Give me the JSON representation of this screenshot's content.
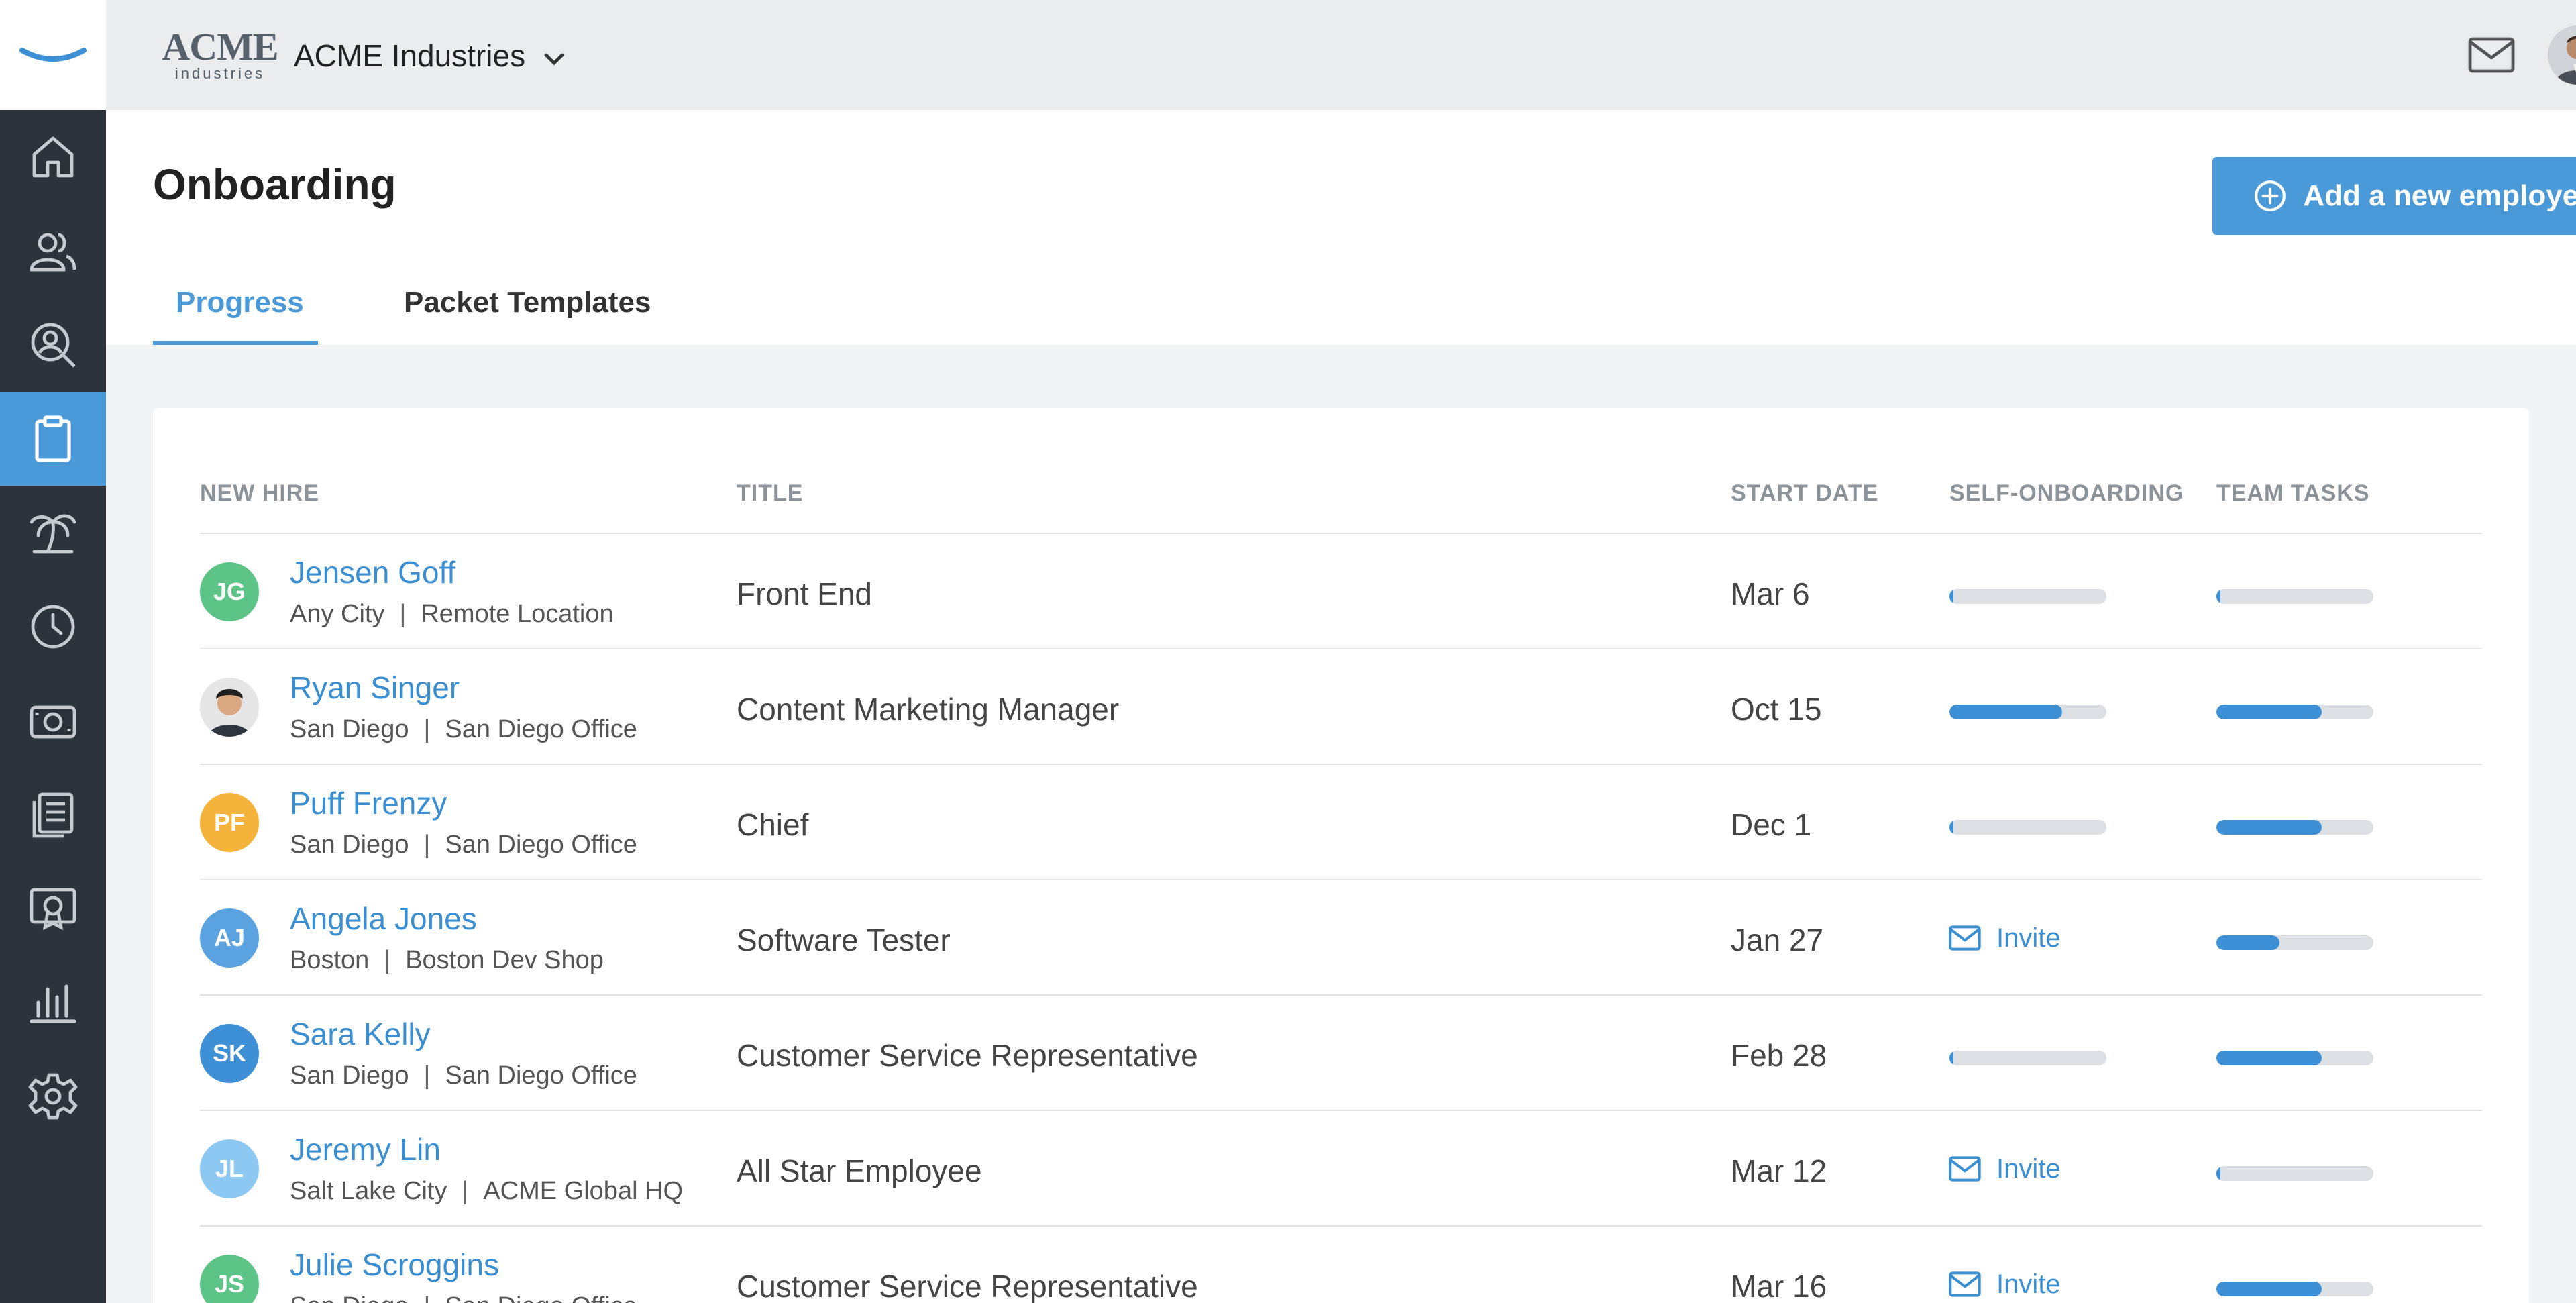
{
  "topbar": {
    "logo_main": "ACME",
    "logo_sub": "industries",
    "company_name": "ACME Industries"
  },
  "sidebar": {
    "items": [
      {
        "icon": "home-icon"
      },
      {
        "icon": "people-icon"
      },
      {
        "icon": "hiring-search-icon"
      },
      {
        "icon": "clipboard-icon",
        "active": true
      },
      {
        "icon": "time-off-palm-icon"
      },
      {
        "icon": "clock-icon"
      },
      {
        "icon": "payroll-money-icon"
      },
      {
        "icon": "documents-icon"
      },
      {
        "icon": "certificate-icon"
      },
      {
        "icon": "reports-chart-icon"
      },
      {
        "icon": "settings-gear-icon"
      }
    ]
  },
  "header": {
    "page_title": "Onboarding",
    "add_button_label": "Add a new employee",
    "tabs": [
      {
        "label": "Progress",
        "active": true
      },
      {
        "label": "Packet Templates",
        "active": false
      }
    ]
  },
  "table": {
    "columns": {
      "new_hire": "NEW HIRE",
      "title": "TITLE",
      "start_date": "START DATE",
      "self_onboarding": "SELF-ONBOARDING",
      "team_tasks": "TEAM TASKS"
    },
    "rows": [
      {
        "initials": "JG",
        "name": "Jensen Goff",
        "city": "Any City",
        "office": "Remote Location",
        "title": "Front End",
        "start_date": "Mar 6",
        "self_onboarding": 0.02,
        "invite": null,
        "team_tasks": 0.02,
        "avatar_color": "#5cc486"
      },
      {
        "initials": "",
        "name": "Ryan Singer",
        "city": "San Diego",
        "office": "San Diego Office",
        "title": "Content Marketing Manager",
        "start_date": "Oct 15",
        "self_onboarding": 0.72,
        "invite": null,
        "team_tasks": 0.67,
        "avatar_color": "#d9d9d9"
      },
      {
        "initials": "PF",
        "name": "Puff Frenzy",
        "city": "San Diego",
        "office": "San Diego Office",
        "title": "Chief",
        "start_date": "Dec 1",
        "self_onboarding": 0.02,
        "invite": null,
        "team_tasks": 0.67,
        "avatar_color": "#f4b33a"
      },
      {
        "initials": "AJ",
        "name": "Angela Jones",
        "city": "Boston",
        "office": "Boston Dev Shop",
        "title": "Software Tester",
        "start_date": "Jan 27",
        "self_onboarding": null,
        "invite": "Invite",
        "team_tasks": 0.4,
        "avatar_color": "#5aa2e0"
      },
      {
        "initials": "SK",
        "name": "Sara Kelly",
        "city": "San Diego",
        "office": "San Diego Office",
        "title": "Customer Service Representative",
        "start_date": "Feb 28",
        "self_onboarding": 0.02,
        "invite": null,
        "team_tasks": 0.67,
        "avatar_color": "#3d8fd6"
      },
      {
        "initials": "JL",
        "name": "Jeremy Lin",
        "city": "Salt Lake City",
        "office": "ACME Global HQ",
        "title": "All Star Employee",
        "start_date": "Mar 12",
        "self_onboarding": null,
        "invite": "Invite",
        "team_tasks": 0.02,
        "avatar_color": "#8cc8f2"
      },
      {
        "initials": "JS",
        "name": "Julie Scroggins",
        "city": "San Diego",
        "office": "San Diego Office",
        "title": "Customer Service Representative",
        "start_date": "Mar 16",
        "self_onboarding": null,
        "invite": "Invite",
        "team_tasks": 0.67,
        "avatar_color": "#5cc486"
      }
    ]
  },
  "colors": {
    "accent": "#4a9ad9",
    "link": "#3a8fd3",
    "sidebar_bg": "#2c333b",
    "bar_track": "#dcdfe3",
    "bar_fill": "#3d8fd6"
  }
}
